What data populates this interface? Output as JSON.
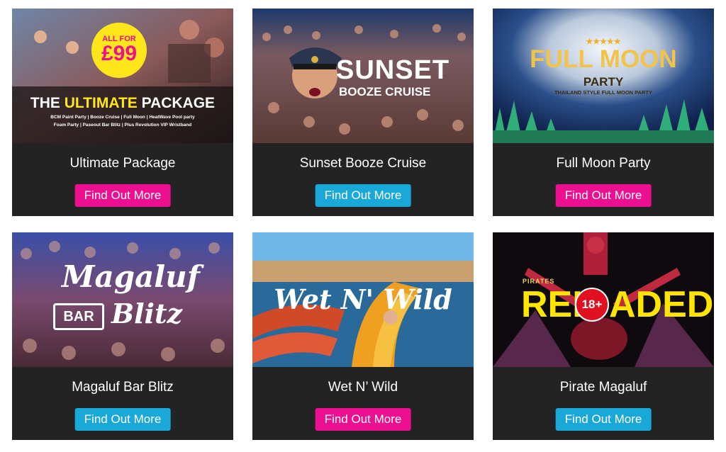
{
  "colors": {
    "pink": "#ec0f8f",
    "blue": "#1aa8d9",
    "card_bg": "#232323"
  },
  "cards": [
    {
      "title": "Ultimate Package",
      "button": "Find Out More",
      "button_color": "pink",
      "image": {
        "badge_line1": "ALL FOR",
        "badge_line2": "£99",
        "headline_a": "THE ",
        "headline_b": "ULTIMATE",
        "headline_c": " PACKAGE",
        "line1": "BCM Paint Party | Booze Cruise | Full Moon | HeatWave Pool party",
        "line2": "Foam Party | Paseout Bar Blitz | Plus Revolution VIP Wristband"
      }
    },
    {
      "title": "Sunset Booze Cruise",
      "button": "Find Out More",
      "button_color": "blue",
      "image": {
        "logo_line1": "SUNSET",
        "logo_line2": "BOOZE CRUISE"
      }
    },
    {
      "title": "Full Moon Party",
      "button": "Find Out More",
      "button_color": "pink",
      "image": {
        "stars": "★★★★★",
        "logo_line1": "FULL MOON",
        "logo_line2": "PARTY",
        "tagline": "THAILAND STYLE FULL MOON PARTY"
      }
    },
    {
      "title": "Magaluf Bar Blitz",
      "button": "Find Out More",
      "button_color": "blue",
      "image": {
        "logo_line1": "Magaluf",
        "logo_bar": "BAR",
        "logo_line2": "Blitz"
      }
    },
    {
      "title": "Wet N’ Wild",
      "button": "Find Out More",
      "button_color": "pink",
      "image": {
        "logo": "Wet N' Wild"
      }
    },
    {
      "title": "Pirate Magaluf",
      "button": "Find Out More",
      "button_color": "blue",
      "image": {
        "small": "PIRATES",
        "logo_a": "REL",
        "badge": "18+",
        "logo_b": "ADED"
      }
    }
  ]
}
